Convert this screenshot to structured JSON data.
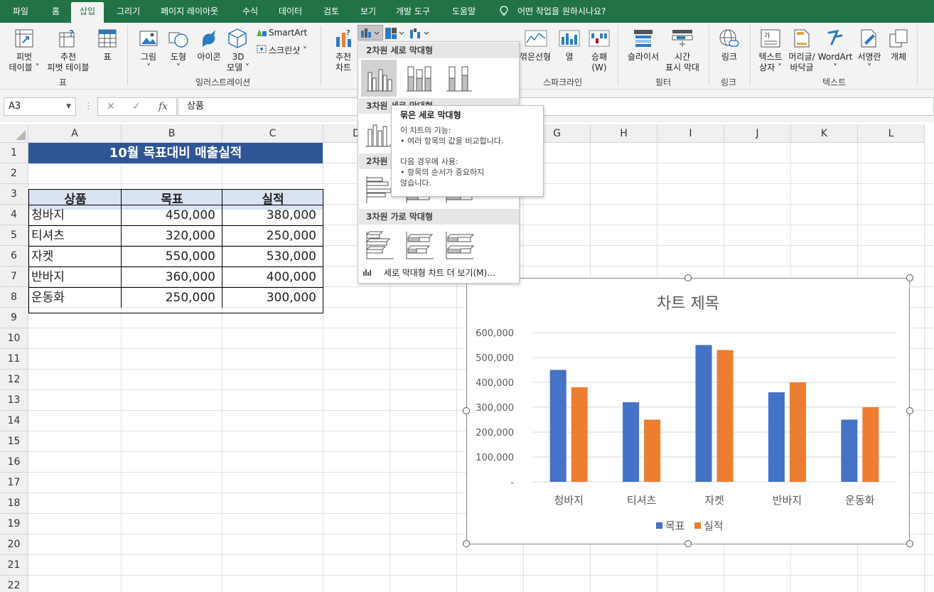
{
  "tabs": [
    "파일",
    "홈",
    "삽입",
    "그리기",
    "페이지 레이아웃",
    "수식",
    "데이터",
    "검토",
    "보기",
    "개발 도구",
    "도움말"
  ],
  "active_tab": "삽입",
  "tell_me": "어떤 작업을 원하시나요?",
  "ribbon": {
    "pivot_table": [
      "피벗",
      "테이블 ˅"
    ],
    "recommended_pivot": [
      "추천",
      "피벗 테이블"
    ],
    "table": "표",
    "group_table": "표",
    "picture": "그림",
    "shapes": "도형",
    "icons": "아이콘",
    "model_3d": [
      "3D",
      "모델 ˅"
    ],
    "smartart": "SmartArt",
    "screenshot": "스크린샷 ˅",
    "group_illustrations": "일러스트레이션",
    "recommended_charts": [
      "추천",
      "차트"
    ],
    "sparkline_line": "꺾은선형",
    "sparkline_column": "열",
    "sparkline_winloss": [
      "승패",
      "(W)"
    ],
    "group_sparklines": "스파크라인",
    "slicer": "슬라이서",
    "timeline": [
      "시간",
      "표시 막대"
    ],
    "group_filters": "필터",
    "link": "링크",
    "group_links": "링크",
    "textbox": [
      "텍스트",
      "상자 ˅"
    ],
    "header_footer": [
      "머리글/",
      "바닥글"
    ],
    "wordart": "WordArt",
    "signature": "서명란",
    "object": "개체",
    "group_text": "텍스트"
  },
  "formula_bar": {
    "name_box": "A3",
    "fx": "fx",
    "content": "상품"
  },
  "columns": [
    "A",
    "B",
    "C",
    "D",
    "E",
    "F",
    "G",
    "H",
    "I",
    "J",
    "K",
    "L"
  ],
  "rows": [
    "1",
    "2",
    "3",
    "4",
    "5",
    "6",
    "7",
    "8",
    "9",
    "10",
    "11",
    "12",
    "13",
    "14",
    "15",
    "16",
    "17",
    "18",
    "19",
    "20",
    "21",
    "22"
  ],
  "sheet": {
    "title": "10월 목표대비 매출실적",
    "headers": [
      "상품",
      "목표",
      "실적"
    ],
    "rows": [
      [
        "청바지",
        "450,000",
        "380,000"
      ],
      [
        "티셔츠",
        "320,000",
        "250,000"
      ],
      [
        "자켓",
        "550,000",
        "530,000"
      ],
      [
        "반바지",
        "360,000",
        "400,000"
      ],
      [
        "운동화",
        "250,000",
        "300,000"
      ]
    ]
  },
  "gallery": {
    "section_2d_column": "2차원 세로 막대형",
    "section_3d_column": "3차원 세로 막대형",
    "section_2d_bar": "2차원 가로 막대형",
    "section_3d_bar": "3차원 가로 막대형",
    "more_link": "세로 막대형 차트 더 보기(M)..."
  },
  "tooltip": {
    "title": "묶은 세로 막대형",
    "line1": "이 차트의 기능:",
    "line2": "• 여러 항목의 값을 비교합니다.",
    "line3": "다음 경우에 사용:",
    "line4": "• 항목의 순서가 중요하지",
    "line5": "않습니다."
  },
  "chart_data": {
    "type": "bar",
    "title": "차트 제목",
    "categories": [
      "청바지",
      "티셔츠",
      "자켓",
      "반바지",
      "운동화"
    ],
    "series": [
      {
        "name": "목표",
        "values": [
          450000,
          320000,
          550000,
          360000,
          250000
        ],
        "color": "#4472c4"
      },
      {
        "name": "실적",
        "values": [
          380000,
          250000,
          530000,
          400000,
          300000
        ],
        "color": "#ed7d31"
      }
    ],
    "ylim": [
      0,
      600000
    ],
    "yticks": [
      "-",
      "100,000",
      "200,000",
      "300,000",
      "400,000",
      "500,000",
      "600,000"
    ],
    "grid": true,
    "legend": "bottom"
  }
}
